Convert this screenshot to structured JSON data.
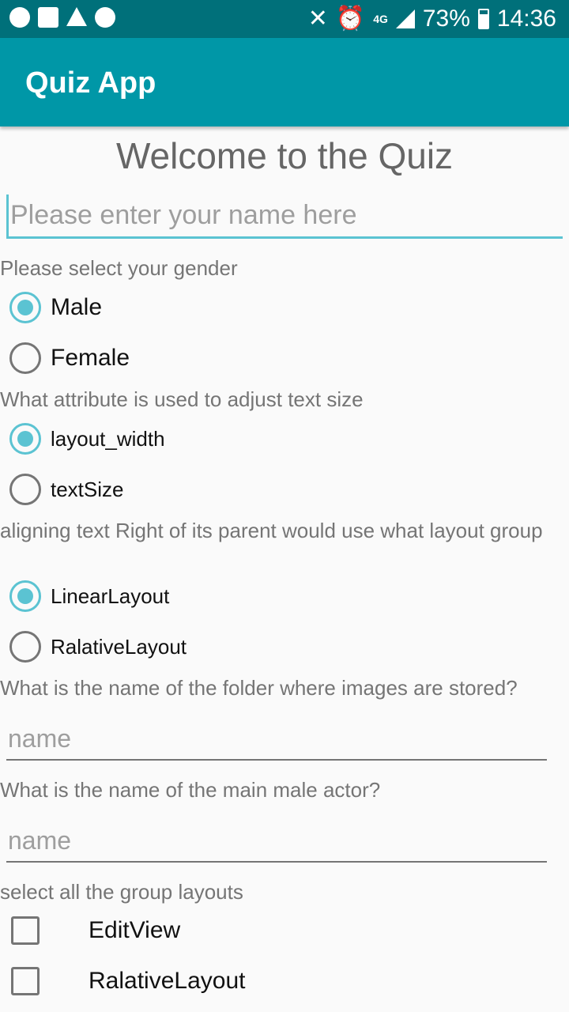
{
  "status": {
    "battery": "73%",
    "time": "14:36",
    "network": "4G"
  },
  "app": {
    "title": "Quiz App"
  },
  "main": {
    "title": "Welcome to the Quiz",
    "name_placeholder": "Please enter your name here",
    "gender": {
      "question": "Please select your gender",
      "options": [
        "Male",
        "Female"
      ]
    },
    "q1": {
      "question": "What attribute is used to adjust text size",
      "options": [
        "layout_width",
        "textSize"
      ]
    },
    "q2": {
      "question": "aligning text Right of its parent would use what layout group",
      "options": [
        "LinearLayout",
        "RalativeLayout"
      ]
    },
    "q3": {
      "question": "What is the name of the folder where images are stored?",
      "placeholder": "name"
    },
    "q4": {
      "question": "What is the name of the main male actor?",
      "placeholder": "name"
    },
    "q5": {
      "question": "select all the group layouts",
      "options": [
        "EditView",
        "RalativeLayout"
      ]
    }
  },
  "colors": {
    "accent": "#5bc3d2",
    "appbar": "#0097a7",
    "statusbar": "#00707a"
  }
}
